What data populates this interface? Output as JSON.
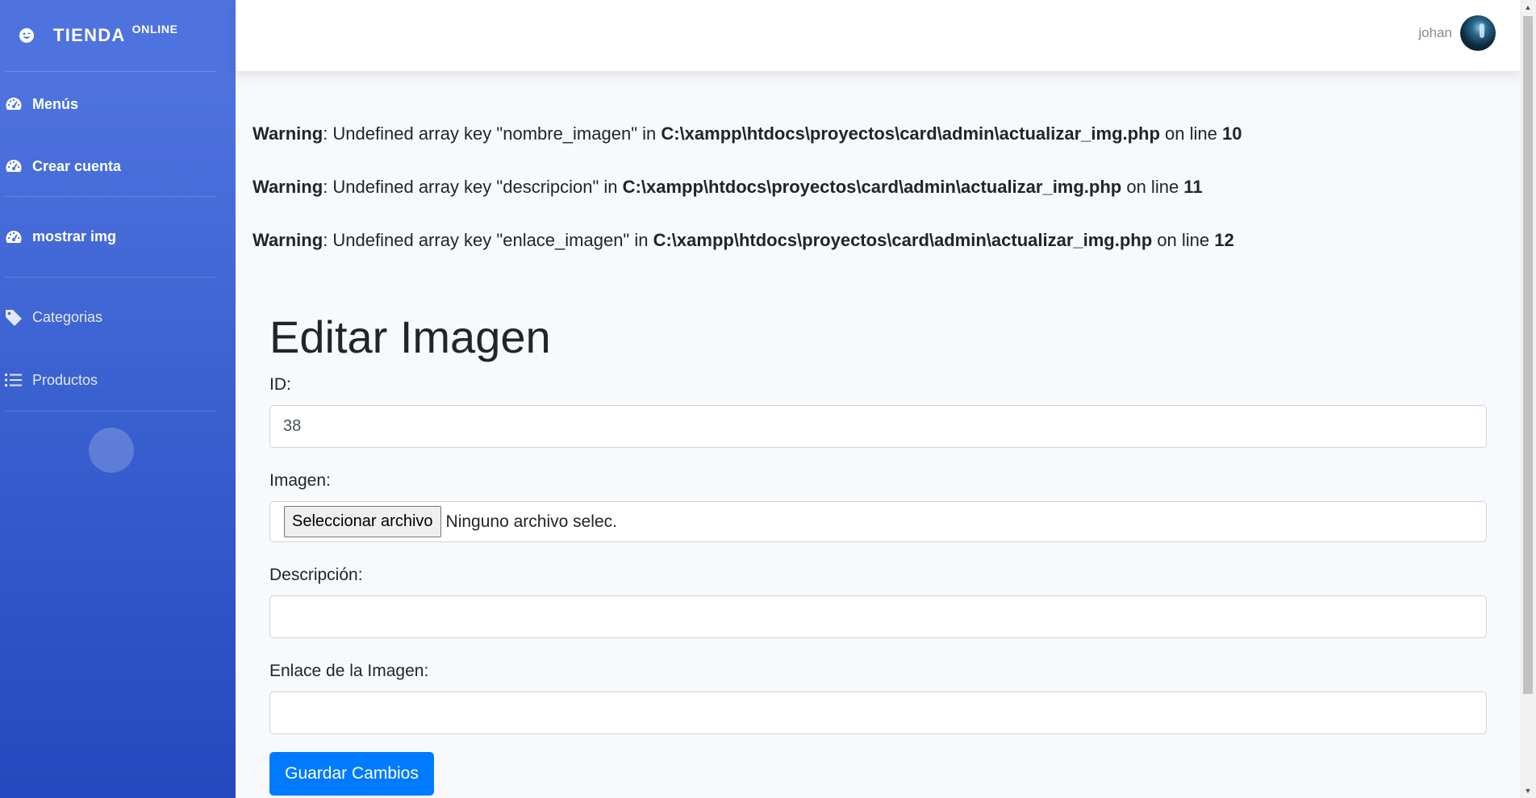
{
  "brand": {
    "name": "TIENDA",
    "sup": "ONLINE",
    "icon": "laugh-wink-icon"
  },
  "sidebar": {
    "items": [
      {
        "label": "Menús",
        "icon": "tachometer-icon"
      },
      {
        "label": "Crear cuenta",
        "icon": "tachometer-icon"
      },
      {
        "label": "mostrar img",
        "icon": "tachometer-icon"
      },
      {
        "label": "Categorias",
        "icon": "tag-icon"
      },
      {
        "label": "Productos",
        "icon": "list-icon"
      }
    ],
    "toggle_glyph": ""
  },
  "topbar": {
    "username": "johan"
  },
  "warnings": [
    {
      "level": "Warning",
      "message": ": Undefined array key \"nombre_imagen\" in ",
      "file": "C:\\xampp\\htdocs\\proyectos\\card\\admin\\actualizar_img.php",
      "on_line": " on line ",
      "line": "10"
    },
    {
      "level": "Warning",
      "message": ": Undefined array key \"descripcion\" in ",
      "file": "C:\\xampp\\htdocs\\proyectos\\card\\admin\\actualizar_img.php",
      "on_line": " on line ",
      "line": "11"
    },
    {
      "level": "Warning",
      "message": ": Undefined array key \"enlace_imagen\" in ",
      "file": "C:\\xampp\\htdocs\\proyectos\\card\\admin\\actualizar_img.php",
      "on_line": " on line ",
      "line": "12"
    }
  ],
  "form": {
    "title": "Editar Imagen",
    "id_label": "ID:",
    "id_value": "38",
    "image_label": "Imagen:",
    "file_button": "Seleccionar archivo",
    "file_status": "Ninguno archivo selec.",
    "description_label": "Descripción:",
    "description_value": "",
    "link_label": "Enlace de la Imagen:",
    "link_value": "",
    "submit": "Guardar Cambios"
  },
  "colors": {
    "sidebar_top": "#4e73df",
    "sidebar_bottom": "#224abe",
    "primary_button": "#007bff"
  }
}
